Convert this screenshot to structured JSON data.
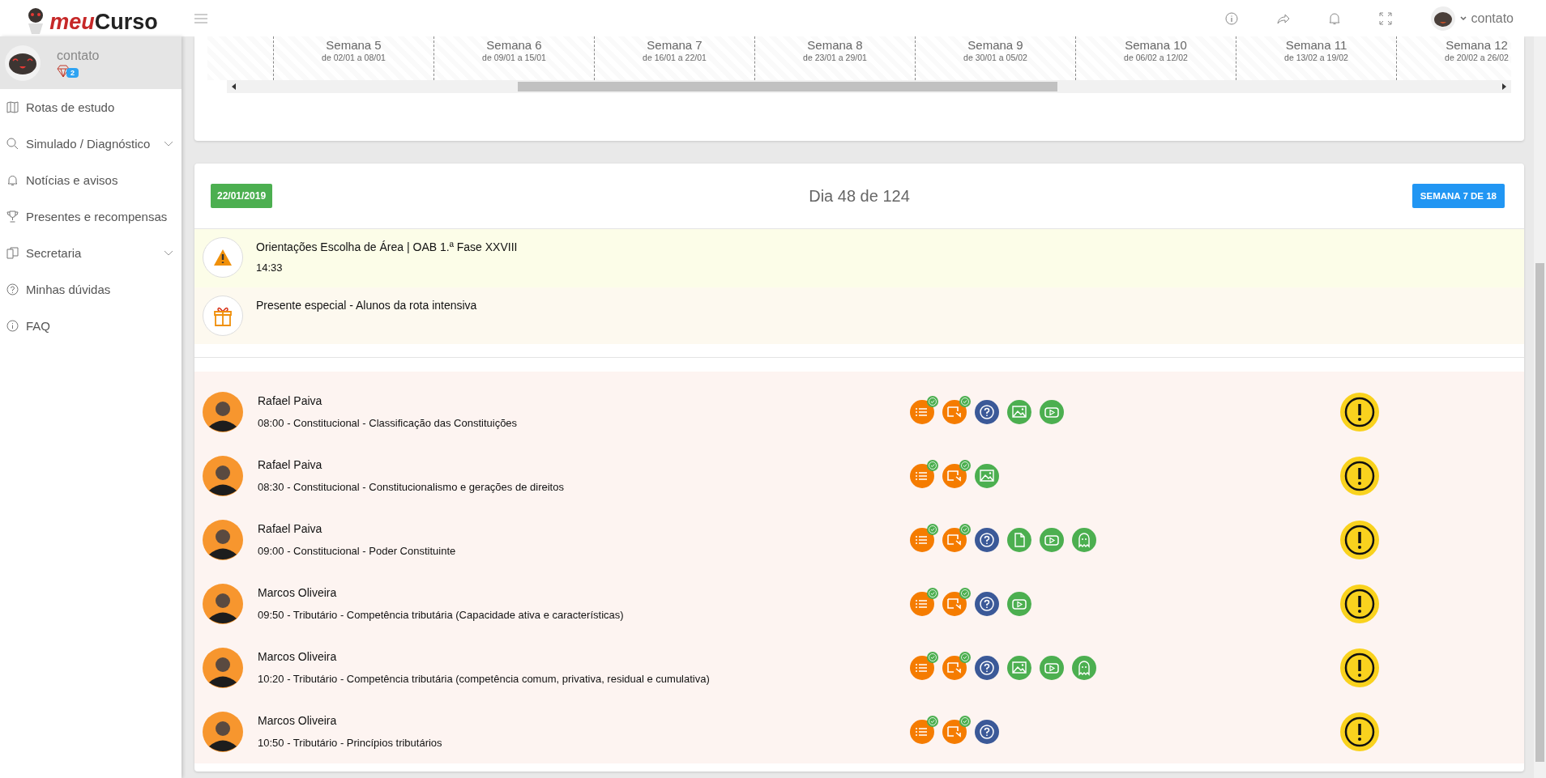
{
  "topbar": {
    "logo_prefix": "meu",
    "logo_suffix": "Curso",
    "user": "contato"
  },
  "profile": {
    "name": "contato",
    "gems": "2"
  },
  "sidebar": {
    "items": [
      {
        "label": "Rotas de estudo",
        "kind": "map",
        "has_submenu": false
      },
      {
        "label": "Simulado / Diagnóstico",
        "kind": "search",
        "has_submenu": true
      },
      {
        "label": "Notícias e avisos",
        "kind": "bell",
        "has_submenu": false
      },
      {
        "label": "Presentes e recompensas",
        "kind": "trophy",
        "has_submenu": false
      },
      {
        "label": "Secretaria",
        "kind": "docs",
        "has_submenu": true
      },
      {
        "label": "Minhas dúvidas",
        "kind": "question",
        "has_submenu": false
      },
      {
        "label": "FAQ",
        "kind": "info",
        "has_submenu": false
      }
    ]
  },
  "weeks": [
    {
      "title": "Semana 5",
      "range": "de 02/01 a 08/01"
    },
    {
      "title": "Semana 6",
      "range": "de 09/01 a 15/01"
    },
    {
      "title": "Semana 7",
      "range": "de 16/01 a 22/01"
    },
    {
      "title": "Semana 8",
      "range": "de 23/01 a 29/01"
    },
    {
      "title": "Semana 9",
      "range": "de 30/01 a 05/02"
    },
    {
      "title": "Semana 10",
      "range": "de 06/02 a 12/02"
    },
    {
      "title": "Semana 11",
      "range": "de 13/02 a 19/02"
    },
    {
      "title": "Semana 12",
      "range": "de 20/02 a 26/02"
    }
  ],
  "day": {
    "date": "22/01/2019",
    "title": "Dia 48 de 124",
    "week_badge": "SEMANA 7 DE 18"
  },
  "notices": [
    {
      "kind": "warning",
      "title": "Orientações Escolha de Área | OAB 1.ª Fase XXVIII",
      "time": "14:33"
    },
    {
      "kind": "gift",
      "title": "Presente especial - Alunos da rota intensiva"
    }
  ],
  "lessons": [
    {
      "teacher": "Rafael Paiva",
      "subject": "08:00 - Constitucional - Classificação das Constituições",
      "resources": [
        {
          "kind": "list",
          "done": true
        },
        {
          "kind": "video",
          "done": true
        },
        {
          "kind": "question",
          "done": false
        },
        {
          "kind": "image",
          "done": false
        },
        {
          "kind": "play",
          "done": false
        }
      ]
    },
    {
      "teacher": "Rafael Paiva",
      "subject": "08:30 - Constitucional - Constitucionalismo e gerações de direitos",
      "resources": [
        {
          "kind": "list",
          "done": true
        },
        {
          "kind": "video",
          "done": true
        },
        {
          "kind": "image",
          "done": false
        }
      ]
    },
    {
      "teacher": "Rafael Paiva",
      "subject": "09:00 - Constitucional - Poder Constituinte",
      "resources": [
        {
          "kind": "list",
          "done": true
        },
        {
          "kind": "video",
          "done": true
        },
        {
          "kind": "question",
          "done": false
        },
        {
          "kind": "document",
          "done": false
        },
        {
          "kind": "play",
          "done": false
        },
        {
          "kind": "ghost",
          "done": false
        }
      ]
    },
    {
      "teacher": "Marcos Oliveira",
      "subject": "09:50 - Tributário - Competência tributária (Capacidade ativa e características)",
      "resources": [
        {
          "kind": "list",
          "done": true
        },
        {
          "kind": "video",
          "done": true
        },
        {
          "kind": "question",
          "done": false
        },
        {
          "kind": "play",
          "done": false
        }
      ]
    },
    {
      "teacher": "Marcos Oliveira",
      "subject": "10:20 - Tributário - Competência tributária (competência comum, privativa, residual e cumulativa)",
      "resources": [
        {
          "kind": "list",
          "done": true
        },
        {
          "kind": "video",
          "done": true
        },
        {
          "kind": "question",
          "done": false
        },
        {
          "kind": "image",
          "done": false
        },
        {
          "kind": "play",
          "done": false
        },
        {
          "kind": "ghost",
          "done": false
        }
      ]
    },
    {
      "teacher": "Marcos Oliveira",
      "subject": "10:50 - Tributário - Princípios tributários",
      "resources": [
        {
          "kind": "list",
          "done": true
        },
        {
          "kind": "video",
          "done": true
        },
        {
          "kind": "question",
          "done": false
        }
      ]
    }
  ]
}
